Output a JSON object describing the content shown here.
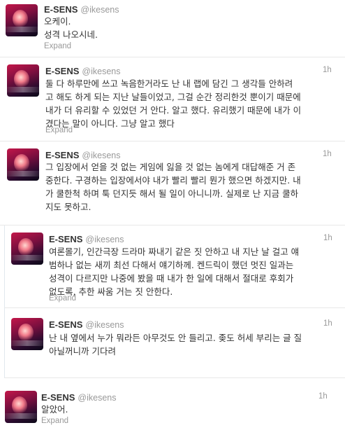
{
  "user": {
    "name": "E-SENS",
    "handle": "@ikesens"
  },
  "expand_label": "Expand",
  "tweets": [
    {
      "time": "",
      "lines": [
        "오케이.",
        "성격 나오시네."
      ]
    },
    {
      "time": "1h",
      "lines": [
        "둘 다 하루만에 쓰고 녹음한거라도 난 내 랩에 담긴 그 생각들  안하려",
        "고 해도 하게 되는 지난 날들이었고, 그걸 순간 정리한것 뿐이기 때문에",
        "내가 더 유리할 수 있었던 거 안다. 알고 했다. 유리했기 때문에 내가 이",
        "겼다는 말이 아니다. 그냥 알고 했다"
      ]
    },
    {
      "time": "1h",
      "lines": [
        "그 입장에서 얻을 것 없는 게임에 잃을 것 없는 놈에게 대답해준 거 존",
        "중한다. 구경하는 입장에서야 내가 빨리 빨리 뭔가 했으면 하겠지만. 내",
        "가 쿨한척 하며 툭 던지듯 해서 될 일이 아니니까. 실제로 난 지금 쿨하",
        "지도 못하고."
      ]
    },
    {
      "time": "1h",
      "lines": [
        "여론몰기, 인간극장 드라마 짜내기 같은 짓 안하고 내 지난 날 걸고 얘",
        "범하나 없는 새끼 최선 다해서 얘기하께.  켄드릭이 했던 멋진 일과는",
        "성격이 다르지만 나중에 봤을 때 내가 한 일에 대해서 절대로  후회가",
        "없도록, 추한 싸움 거는 짓 안한다."
      ]
    },
    {
      "time": "1h",
      "lines": [
        "난 내 옆에서 누가 뭐라든 아무것도 안 들리고. 좆도 허세 부리는 글 질",
        "아닐꺼니까 기다려"
      ]
    },
    {
      "time": "1h",
      "lines": [
        "알았어."
      ]
    }
  ]
}
